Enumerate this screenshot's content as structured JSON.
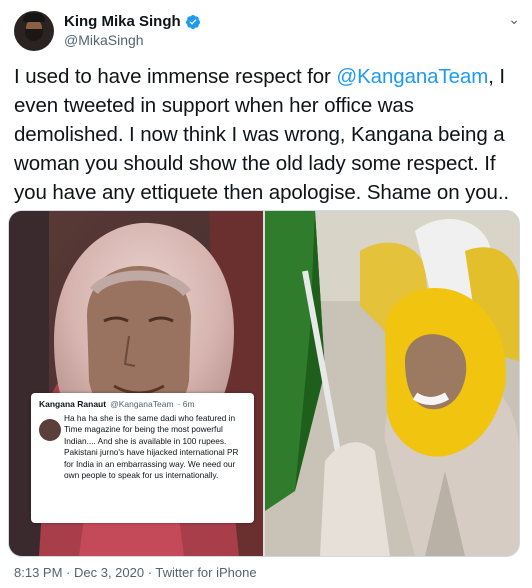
{
  "author": {
    "name": "King Mika Singh",
    "handle": "@MikaSingh"
  },
  "tweet": {
    "text_before": "I used to have immense respect for ",
    "mention": "@KanganaTeam",
    "text_after": ", I even tweeted in support when her office was demolished. I now think I was wrong, Kangana being a woman you should show the old lady some respect. If you have any ettiquete then apologise. Shame on you.."
  },
  "embedded_tweet": {
    "name": "Kangana Ranaut",
    "handle": "@KanganaTeam",
    "time": "· 6m",
    "text": "Ha ha ha she is the same dadi who featured in Time magazine for being the most powerful Indian.... And she is available in 100 rupees. Pakistani jurno's have hijacked international PR for India in an embarrassing way. We need our own people to speak for us internationally."
  },
  "footer": {
    "time": "8:13 PM",
    "date": "Dec 3, 2020",
    "source": "Twitter for iPhone",
    "separator": " · "
  },
  "colors": {
    "link": "#1d9bf0",
    "muted": "#536471",
    "verified": "#1d9bf0"
  },
  "icons": [
    "verified-badge-icon",
    "chevron-down-icon"
  ]
}
